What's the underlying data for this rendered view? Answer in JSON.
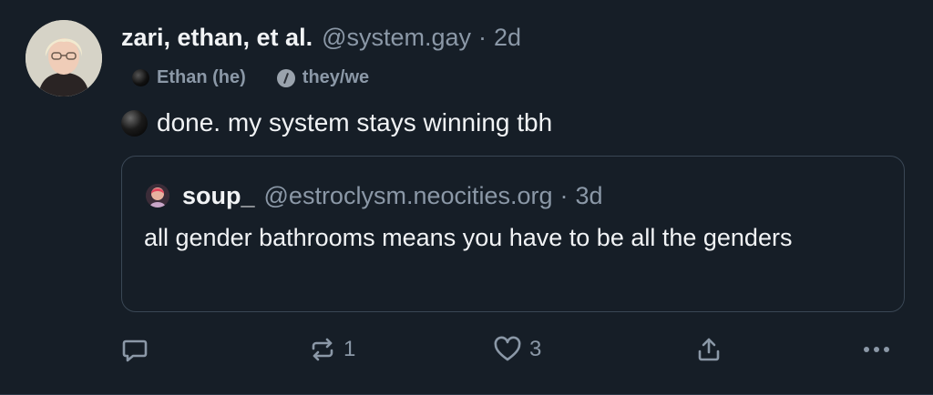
{
  "post": {
    "display_name": "zari, ethan, et al.",
    "handle": "@system.gay",
    "separator": "·",
    "timestamp": "2d",
    "tags": [
      {
        "label": "Ethan (he)",
        "icon": "black-circle-icon"
      },
      {
        "label": "they/we",
        "icon": "pronoun-slash-icon"
      }
    ],
    "text": "done. my system stays winning tbh",
    "text_emoji": "black-ball-emoji-icon"
  },
  "quote": {
    "display_name": "soup_",
    "handle": "@estroclysm.neocities.org",
    "separator": "·",
    "timestamp": "3d",
    "text": "all gender bathrooms means you have to be all the genders"
  },
  "actions": {
    "reply_icon": "reply-icon",
    "repost_icon": "repost-icon",
    "repost_count": "1",
    "like_icon": "heart-icon",
    "like_count": "3",
    "share_icon": "share-icon",
    "more_icon": "more-icon"
  },
  "colors": {
    "background": "#161e27",
    "text_primary": "#f1f3f5",
    "text_secondary": "#8b98a7",
    "border": "#3a4755"
  }
}
